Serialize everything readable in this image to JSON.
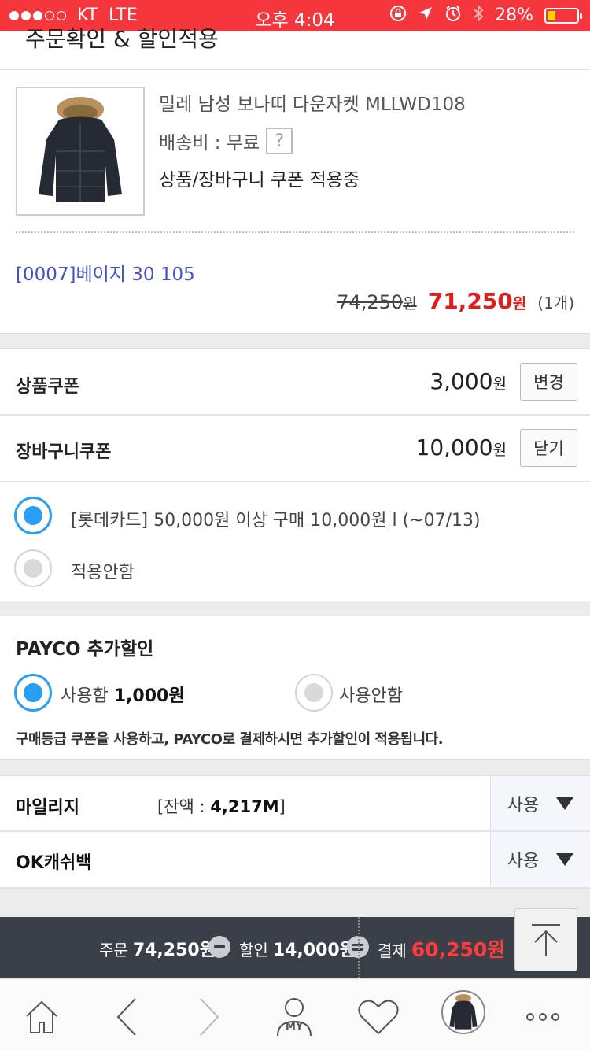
{
  "status_bar": {
    "carrier": "KT",
    "network": "LTE",
    "time": "오후 4:04",
    "battery": "28%",
    "battery_level": 0.28,
    "signal_bars": 3,
    "signal_total": 5
  },
  "header": {
    "title": "주문확인 & 할인적용"
  },
  "product": {
    "name": "밀레 남성 보나띠 다운자켓 MLLWD108",
    "shipping_label": "배송비 : 무료",
    "help_icon": "?",
    "coupon_status": "상품/장바구니 쿠폰 적용중",
    "option": "[0007]베이지 30 105",
    "original_price": "74,250",
    "sale_price": "71,250",
    "currency": "원",
    "quantity": "(1개)"
  },
  "coupons": {
    "product": {
      "label": "상품쿠폰",
      "amount": "3,000",
      "unit": "원",
      "button": "변경"
    },
    "cart": {
      "label": "장바구니쿠폰",
      "amount": "10,000",
      "unit": "원",
      "button": "닫기"
    },
    "options": [
      {
        "label": "[롯데카드] 50,000원 이상 구매 10,000원 l (~07/13)",
        "selected": true
      },
      {
        "label": "적용안함",
        "selected": false
      }
    ]
  },
  "payco": {
    "title": "PAYCO 추가할인",
    "use_label": "사용함",
    "use_amount": "1,000원",
    "no_use_label": "사용안함",
    "selected": "use",
    "note": "구매등급 쿠폰을 사용하고, PAYCO로 결제하시면 추가할인이 적용됩니다."
  },
  "mileage": {
    "label": "마일리지",
    "balance_prefix": "[잔액 : ",
    "balance": "4,217M",
    "balance_suffix": "]",
    "action": "사용"
  },
  "okcashbag": {
    "label": "OK캐쉬백",
    "action": "사용"
  },
  "summary": {
    "order_label": "주문",
    "order_amount": "74,250원",
    "discount_label": "할인",
    "discount_amount": "14,000원",
    "pay_label": "결제",
    "pay_amount": "60,250원"
  },
  "tabbar": {
    "my_label": "MY"
  },
  "colors": {
    "status_bar": "#f5363d",
    "accent_blue": "#2a9df4",
    "sale_red": "#e21b1b",
    "option_blue": "#4750c9",
    "summary_bg": "#3b4048"
  }
}
